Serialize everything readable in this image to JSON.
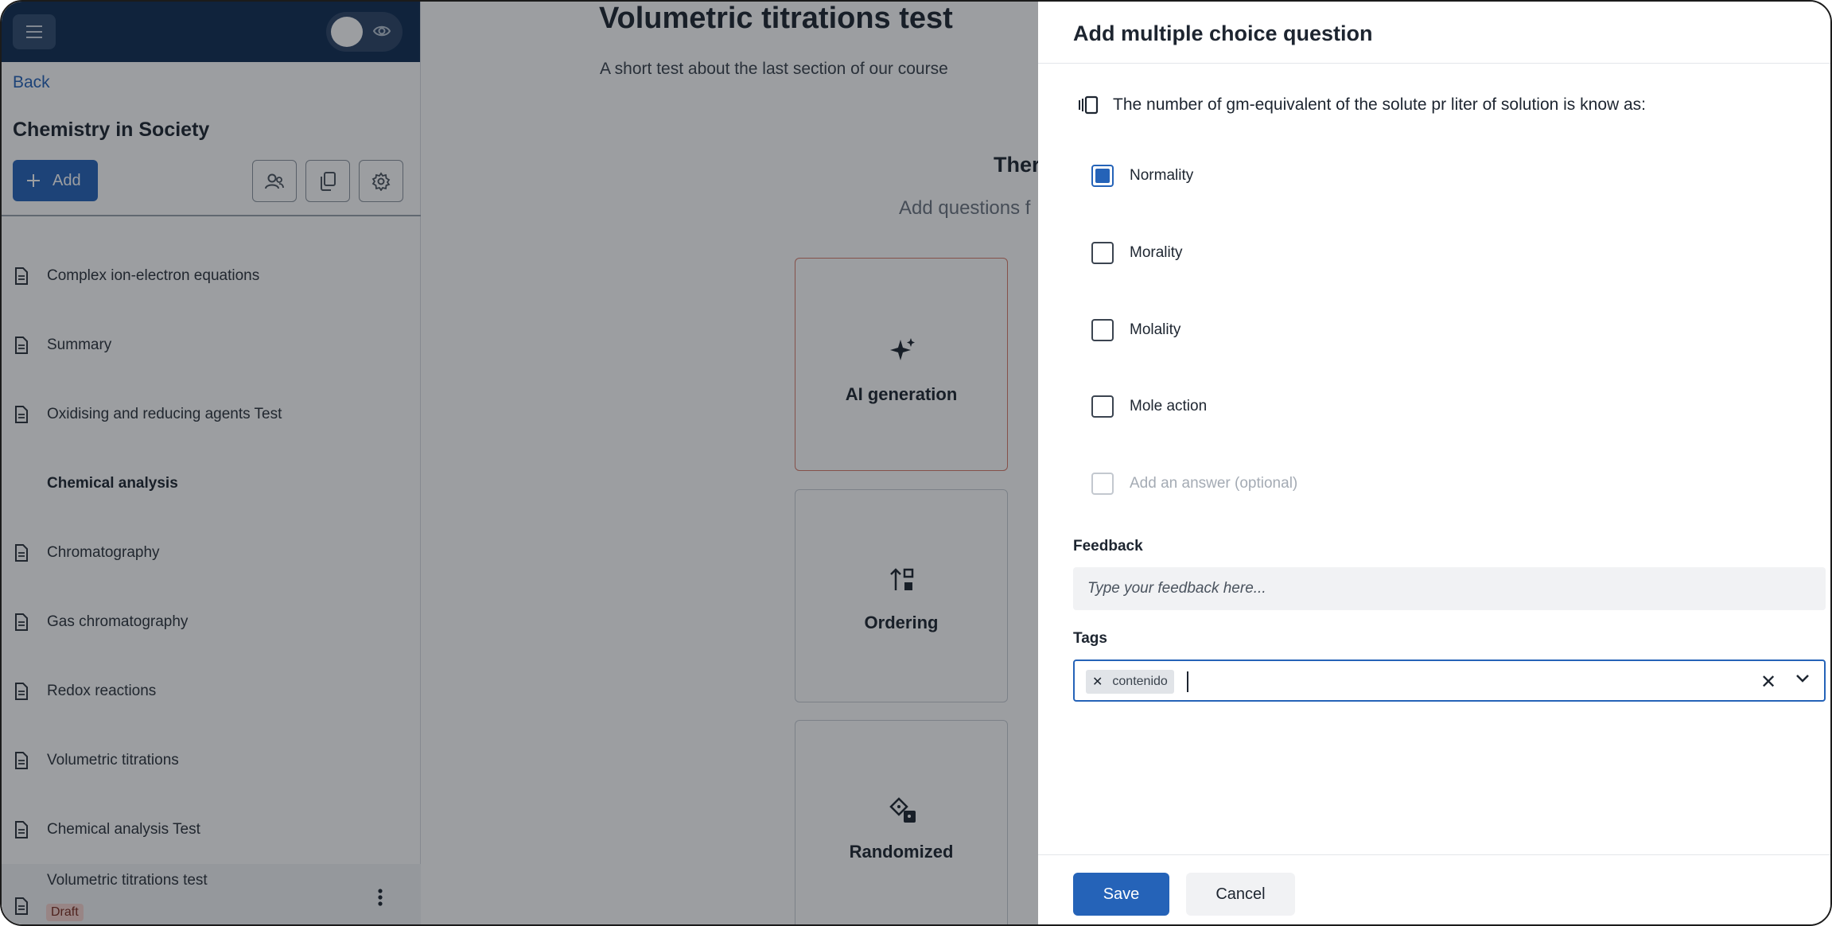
{
  "sidebar": {
    "back_label": "Back",
    "course_title": "Chemistry in Society",
    "add_label": "Add",
    "items": [
      {
        "label": "Complex ion-electron equations",
        "kind": "doc"
      },
      {
        "label": "Summary",
        "kind": "doc"
      },
      {
        "label": "Oxidising and reducing agents Test",
        "kind": "doc"
      },
      {
        "label": "Chemical analysis",
        "kind": "section"
      },
      {
        "label": "Chromatography",
        "kind": "doc"
      },
      {
        "label": "Gas chromatography",
        "kind": "doc"
      },
      {
        "label": "Redox reactions",
        "kind": "doc"
      },
      {
        "label": "Volumetric titrations",
        "kind": "doc"
      },
      {
        "label": "Chemical analysis Test",
        "kind": "doc"
      },
      {
        "label": "Volumetric titrations test",
        "kind": "doc",
        "badge": "Draft"
      }
    ]
  },
  "main": {
    "title": "Volumetric titrations test",
    "description": "A short test about the last section of our course",
    "empty_heading": "Ther",
    "empty_sub": "Add questions f",
    "cards": [
      {
        "label": "AI generation",
        "icon": "sparkles-icon"
      },
      {
        "label": "Ordering",
        "icon": "sort-icon"
      },
      {
        "label": "Randomized",
        "icon": "dice-icon"
      }
    ]
  },
  "panel": {
    "title": "Add multiple choice question",
    "question": "The number of gm-equivalent of the solute pr liter of solution is know as:",
    "options": [
      {
        "label": "Normality",
        "checked": true
      },
      {
        "label": "Morality",
        "checked": false
      },
      {
        "label": "Molality",
        "checked": false
      },
      {
        "label": "Mole action",
        "checked": false
      }
    ],
    "add_answer_placeholder": "Add an answer (optional)",
    "feedback_label": "Feedback",
    "feedback_placeholder": "Type your feedback here...",
    "tags_label": "Tags",
    "tags": [
      "contenido"
    ],
    "save_label": "Save",
    "cancel_label": "Cancel"
  },
  "colors": {
    "brand_dark": "#0f2c52",
    "accent": "#2563b8",
    "draft_badge": "#f9d5cf"
  }
}
